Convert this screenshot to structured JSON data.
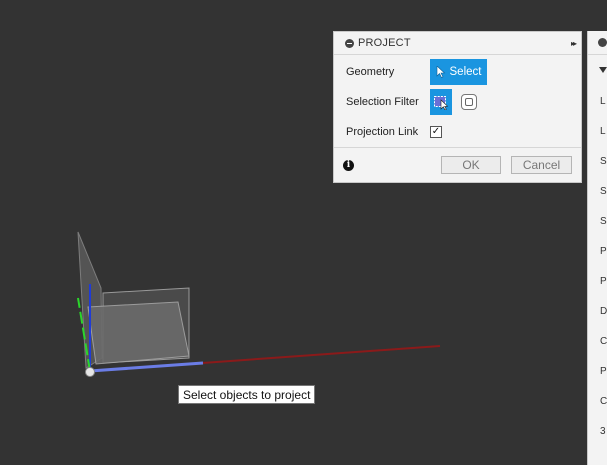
{
  "dialog": {
    "title": "PROJECT",
    "expand_glyph": "▸▸",
    "geometry_label": "Geometry",
    "select_label": "Select",
    "selection_filter_label": "Selection Filter",
    "projection_link_label": "Projection Link",
    "projection_link_checked": "✓",
    "info_glyph": "i",
    "ok_label": "OK",
    "cancel_label": "Cancel"
  },
  "side_panel": {
    "items": [
      "L",
      "L",
      "S",
      "S",
      "S",
      "P",
      "P",
      "D",
      "C",
      "P",
      "C",
      "3"
    ]
  },
  "tooltip": {
    "text": "Select objects to project"
  },
  "colors": {
    "viewport_bg": "#333333",
    "accent_blue": "#1a95e0",
    "x_axis": "#8b1a1a",
    "y_axis": "#2bd62b",
    "z_axis": "#1f3bd6"
  }
}
